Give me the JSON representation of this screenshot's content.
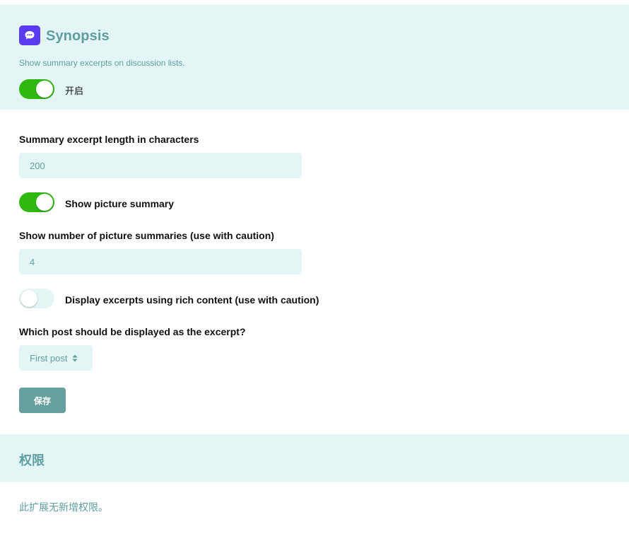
{
  "extension": {
    "icon": "comment-bubble-icon",
    "title": "Synopsis",
    "description": "Show summary excerpts on discussion lists.",
    "enable_label": "开启",
    "enabled": true
  },
  "settings": {
    "excerpt_length_label": "Summary excerpt length in characters",
    "excerpt_length_value": "200",
    "show_picture_label": "Show picture summary",
    "show_picture_enabled": true,
    "picture_count_label": "Show number of picture summaries (use with caution)",
    "picture_count_value": "4",
    "rich_content_label": "Display excerpts using rich content (use with caution)",
    "rich_content_enabled": false,
    "excerpt_post_label": "Which post should be displayed as the excerpt?",
    "excerpt_post_selected": "First post",
    "save_label": "保存"
  },
  "permissions": {
    "title": "权限",
    "note": "此扩展无新增权限。"
  },
  "colors": {
    "accent_teal": "#5f9ea0",
    "panel_bg": "#e3f5f4",
    "toggle_on": "#2fb80f",
    "icon_bg": "#5b3bf0"
  }
}
